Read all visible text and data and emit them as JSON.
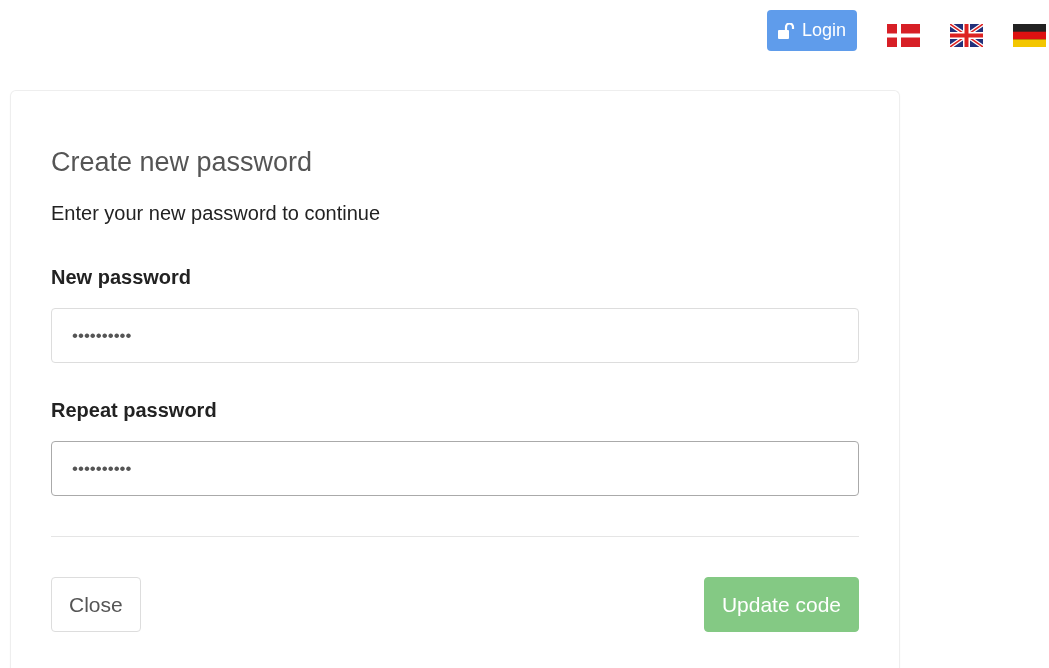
{
  "topbar": {
    "login_button": "Login",
    "languages": [
      {
        "kind": "danish"
      },
      {
        "kind": "british"
      },
      {
        "kind": "german"
      }
    ]
  },
  "card": {
    "title": "Create new password",
    "subtitle": "Enter your new password to continue",
    "fields": [
      {
        "label": "New password",
        "value": "••••••••••",
        "focused": false
      },
      {
        "label": "Repeat password",
        "value": "••••••••••",
        "focused": true
      }
    ],
    "buttons": [
      {
        "label": "Close",
        "kind": "default",
        "disabled": false
      },
      {
        "label": "Update code",
        "kind": "success",
        "disabled": true
      }
    ]
  }
}
